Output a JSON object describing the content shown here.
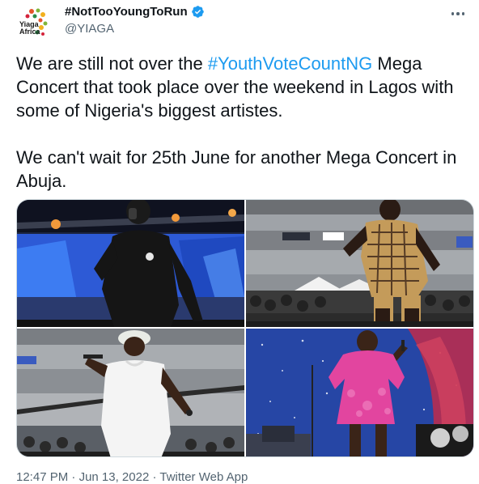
{
  "author": {
    "display_name": "#NotTooYoungToRun",
    "handle": "@YIAGA",
    "avatar_text": "Yiaga Africa"
  },
  "tweet": {
    "line1_before": "We are still not over the ",
    "hashtag": "#YouthVoteCountNG",
    "line1_after": " Mega Concert that took place over the weekend in Lagos with some of Nigeria's biggest artistes.",
    "paragraph2": "We can't wait for 25th June for another Mega Concert in Abuja."
  },
  "media": {
    "photos": [
      {
        "name": "performer-black-hoodie-photo"
      },
      {
        "name": "performer-patterned-shirt-photo"
      },
      {
        "name": "performer-white-tee-photo"
      },
      {
        "name": "performer-pink-dress-photo"
      }
    ]
  },
  "footer": {
    "time": "12:47 PM",
    "separator": " · ",
    "date": "Jun 13, 2022",
    "source": "Twitter Web App"
  },
  "colors": {
    "link": "#1d9bf0",
    "verified": "#1d9bf0",
    "secondary_text": "#536471"
  }
}
